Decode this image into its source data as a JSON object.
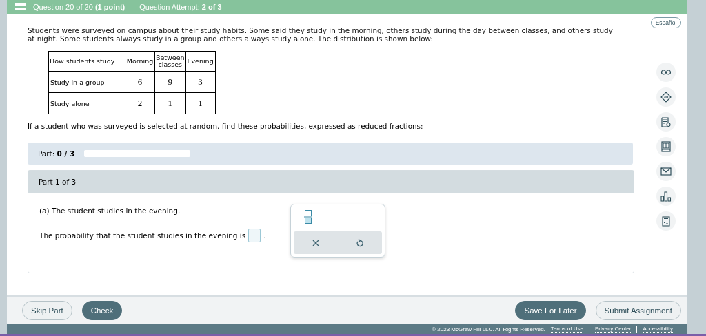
{
  "header": {
    "question": "Question 20 of 20 **(1 point)**",
    "attempt": "Question Attempt: **2 of 3**"
  },
  "language_button": "Español",
  "intro": "Students were surveyed on campus about their study habits. Some said they study in the morning, others study during the day between classes, and others study at night. Some students always study in a group and others always study alone. The distribution is shown below:",
  "table": {
    "columns": [
      "How students study",
      "Morning",
      "Between classes",
      "Evening"
    ],
    "rows": [
      [
        "Study in a group",
        "6",
        "9",
        "3"
      ],
      [
        "Study alone",
        "2",
        "1",
        "1"
      ]
    ]
  },
  "question": "If a student who was surveyed is selected at random, find these probabilities, expressed as reduced fractions:",
  "progress": {
    "label": "Part:",
    "value": "0 / 3"
  },
  "part": {
    "title": "Part 1 of 3",
    "prompt": "(a) The student studies in the evening.",
    "answer_text": "The probability that the student studies in the evening is",
    "answer_end": "."
  },
  "tools": [
    {
      "kind": "glasses"
    },
    {
      "kind": "share"
    },
    {
      "kind": "notes"
    },
    {
      "kind": "ebook"
    },
    {
      "kind": "mail"
    },
    {
      "kind": "chart"
    },
    {
      "kind": "calculator"
    }
  ],
  "footer_buttons": {
    "left": [
      "Skip Part",
      "Check"
    ],
    "right": [
      "Save For Later",
      "Submit Assignment"
    ]
  },
  "legal": {
    "copyright": "© 2023 McGraw Hill LLC. All Rights Reserved.",
    "links": [
      "Terms of Use",
      "Privacy Center",
      "Accessibility"
    ]
  }
}
